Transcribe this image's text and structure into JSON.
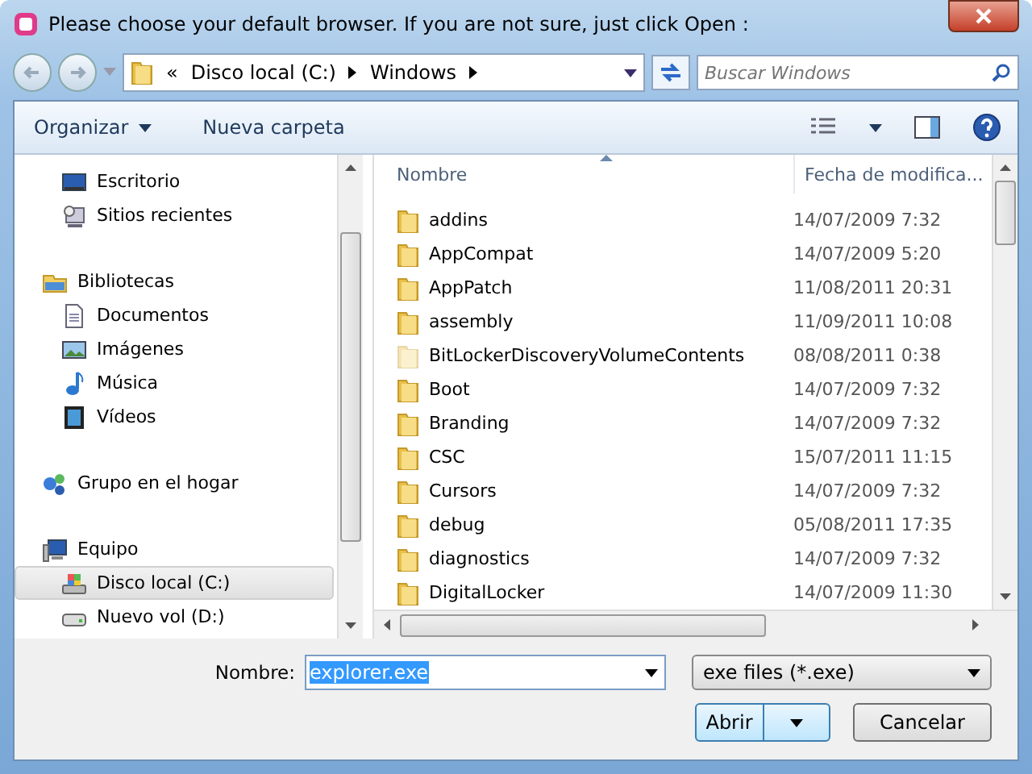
{
  "window": {
    "title": "Please choose your default browser. If you are not sure, just click Open :"
  },
  "address": {
    "overflow": "«",
    "crumbs": [
      "Disco local (C:)",
      "Windows"
    ]
  },
  "search": {
    "placeholder": "Buscar Windows"
  },
  "toolbar": {
    "organize": "Organizar",
    "new_folder": "Nueva carpeta"
  },
  "sidebar": {
    "groups": [
      {
        "children": [
          {
            "label": "Escritorio",
            "selected": false
          },
          {
            "label": "Sitios recientes",
            "selected": false
          }
        ]
      },
      {
        "label": "Bibliotecas",
        "selected": false,
        "children": [
          {
            "label": "Documentos",
            "selected": false
          },
          {
            "label": "Imágenes",
            "selected": false
          },
          {
            "label": "Música",
            "selected": false
          },
          {
            "label": "Vídeos",
            "selected": false
          }
        ]
      },
      {
        "label": "Grupo en el hogar",
        "selected": false
      },
      {
        "label": "Equipo",
        "selected": false,
        "children": [
          {
            "label": "Disco local (C:)",
            "selected": true
          },
          {
            "label": "Nuevo vol (D:)",
            "selected": false
          }
        ]
      }
    ]
  },
  "table": {
    "columns": [
      "Nombre",
      "Fecha de modifica..."
    ],
    "rows": [
      {
        "name": "addins",
        "date": "14/07/2009 7:32",
        "hidden": false
      },
      {
        "name": "AppCompat",
        "date": "14/07/2009 5:20",
        "hidden": false
      },
      {
        "name": "AppPatch",
        "date": "11/08/2011 20:31",
        "hidden": false
      },
      {
        "name": "assembly",
        "date": "11/09/2011 10:08",
        "hidden": false
      },
      {
        "name": "BitLockerDiscoveryVolumeContents",
        "date": "08/08/2011 0:38",
        "hidden": true
      },
      {
        "name": "Boot",
        "date": "14/07/2009 7:32",
        "hidden": false
      },
      {
        "name": "Branding",
        "date": "14/07/2009 7:32",
        "hidden": false
      },
      {
        "name": "CSC",
        "date": "15/07/2011 11:15",
        "hidden": false
      },
      {
        "name": "Cursors",
        "date": "14/07/2009 7:32",
        "hidden": false
      },
      {
        "name": "debug",
        "date": "05/08/2011 17:35",
        "hidden": false
      },
      {
        "name": "diagnostics",
        "date": "14/07/2009 7:32",
        "hidden": false
      },
      {
        "name": "DigitalLocker",
        "date": "14/07/2009 11:30",
        "hidden": false
      }
    ]
  },
  "footer": {
    "name_label": "Nombre:",
    "name_value": "explorer.exe",
    "name_highlighted": true,
    "file_type": "exe files (*.exe)",
    "open": "Abrir",
    "cancel": "Cancelar"
  }
}
